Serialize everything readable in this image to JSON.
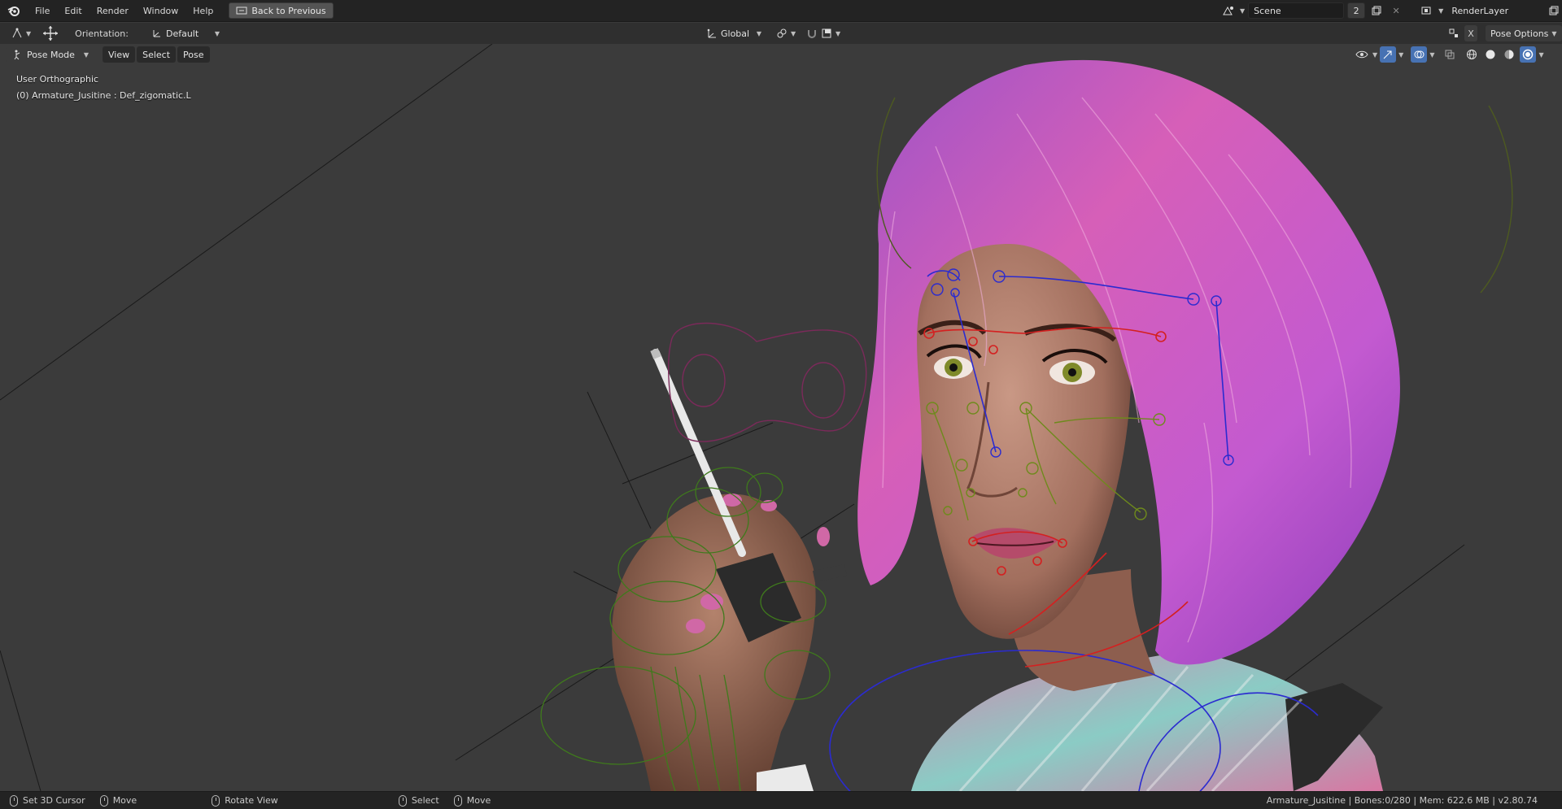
{
  "topbar": {
    "menus": [
      "File",
      "Edit",
      "Render",
      "Window",
      "Help"
    ],
    "back_button": "Back to Previous",
    "scene_name": "Scene",
    "scene_users": "2",
    "renderlayer_name": "RenderLayer"
  },
  "toolheader": {
    "orientation_label": "Orientation:",
    "orientation_value": "Default",
    "transform_orientation": "Global",
    "pose_options": "Pose Options",
    "x_label": "X"
  },
  "viewheader": {
    "mode": "Pose Mode",
    "menus": [
      "View",
      "Select",
      "Pose"
    ]
  },
  "viewport": {
    "view_name": "User Orthographic",
    "active_bone": "(0) Armature_Jusitine : Def_zigomatic.L"
  },
  "statusbar": {
    "left_click": "Set 3D Cursor",
    "middle_drag": "Move",
    "right_click": "Rotate View",
    "select": "Select",
    "move": "Move",
    "info": "Armature_Jusitine | Bones:0/280 | Mem: 622.6 MB | v2.80.74"
  },
  "colors": {
    "topbar_bg": "#232323",
    "viewport_bg": "#3b3b3b",
    "hair_pink": "#d45ec8",
    "rig_blue": "#2b2bd0",
    "rig_red": "#d42020",
    "rig_green": "#4f8a1e"
  }
}
